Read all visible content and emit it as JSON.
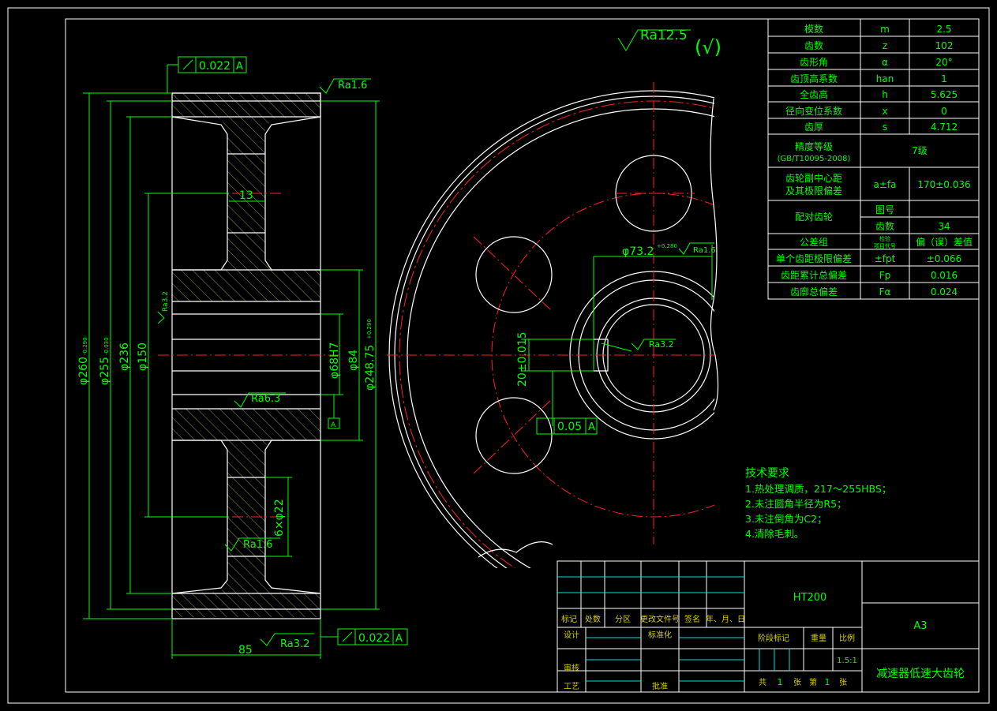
{
  "roughness_top": "Ra12.5",
  "roughness_top_mark": "(√)",
  "colors": {
    "bg": "#000000",
    "outline": "#ffffff",
    "dim": "#00ff00",
    "center": "#ff2020",
    "table_lines": "#00e0e0"
  },
  "section": {
    "flatness_value": "0.022",
    "flatness_datum": "A",
    "ra_face": "Ra1.6",
    "width_13": "13",
    "ra_bore_side": "Ra3.2",
    "ra_hub": "Ra6.3",
    "datum_a": "A",
    "ra_web": "Ra1.6",
    "holes": "6×φ22",
    "bottom_width": "85",
    "ra_bottom": "Ra3.2",
    "runout_value": "0.022",
    "runout_datum": "A",
    "d260": "φ260",
    "d260_tol": "-0.290",
    "d255": "φ255",
    "d255_tol": "-0.030",
    "d236": "φ236",
    "d150": "φ150",
    "d68": "φ68H7",
    "d84": "φ84",
    "d248": "φ248.75",
    "d248_tol": "+0.290"
  },
  "front": {
    "bore_dim": "φ73.2",
    "bore_tol": "+0.280",
    "bore_ra": "Ra1.6",
    "key_ra": "Ra3.2",
    "key_width": "20±0.015",
    "sym_value": "0.05",
    "sym_datum": "A"
  },
  "params": [
    {
      "name": "模数",
      "sym": "m",
      "val": "2.5"
    },
    {
      "name": "齿数",
      "sym": "z",
      "val": "102"
    },
    {
      "name": "齿形角",
      "sym": "α",
      "val": "20°"
    },
    {
      "name": "齿顶高系数",
      "sym": "han",
      "val": "1"
    },
    {
      "name": "全齿高",
      "sym": "h",
      "val": "5.625"
    },
    {
      "name": "径向变位系数",
      "sym": "x",
      "val": "0"
    },
    {
      "name": "齿厚",
      "sym": "s",
      "val": "4.712"
    }
  ],
  "accuracy": {
    "name": "精度等级",
    "std": "(GB/T10095-2008)",
    "val": "7级"
  },
  "center": {
    "name1": "齿轮副中心距",
    "name2": "及其极限偏差",
    "sym": "a±fa",
    "val": "170±0.036"
  },
  "mating": {
    "name": "配对齿轮",
    "r1": "图号",
    "r1v": "",
    "r2": "齿数",
    "r2v": "34"
  },
  "tolgroup": {
    "name": "公差组",
    "sym1": "检验",
    "sym2": "项目代号",
    "val": "偏（误）差值"
  },
  "tol_rows": [
    {
      "name": "单个齿距极限偏差",
      "sym": "±fpt",
      "val": "±0.066"
    },
    {
      "name": "齿距累计总偏差",
      "sym": "Fp",
      "val": "0.016"
    },
    {
      "name": "齿廓总偏差",
      "sym": "Fα",
      "val": "0.024"
    }
  ],
  "tech": {
    "title": "技术要求",
    "items": [
      "1.热处理调质，217～255HBS；",
      "2.未注圆角半径为R5；",
      "3.未注倒角为C2；",
      "4.清除毛刺。"
    ]
  },
  "title_block": {
    "material": "HT200",
    "size": "A3",
    "name": "减速器低速大齿轮",
    "h_mark": "标记",
    "h_count": "处数",
    "h_zone": "分区",
    "h_doc": "更改文件号",
    "h_sign": "签名",
    "h_date": "年、月、日",
    "design": "设计",
    "std": "标准化",
    "review": "审核",
    "craft": "工艺",
    "approve": "批准",
    "stage": "阶段标记",
    "weight": "重量",
    "scale_h": "比例",
    "scale": "1.5:1",
    "total": "共",
    "total_n": "1",
    "sheets": "张",
    "page": "第",
    "page_n": "1",
    "sheets2": "张"
  }
}
